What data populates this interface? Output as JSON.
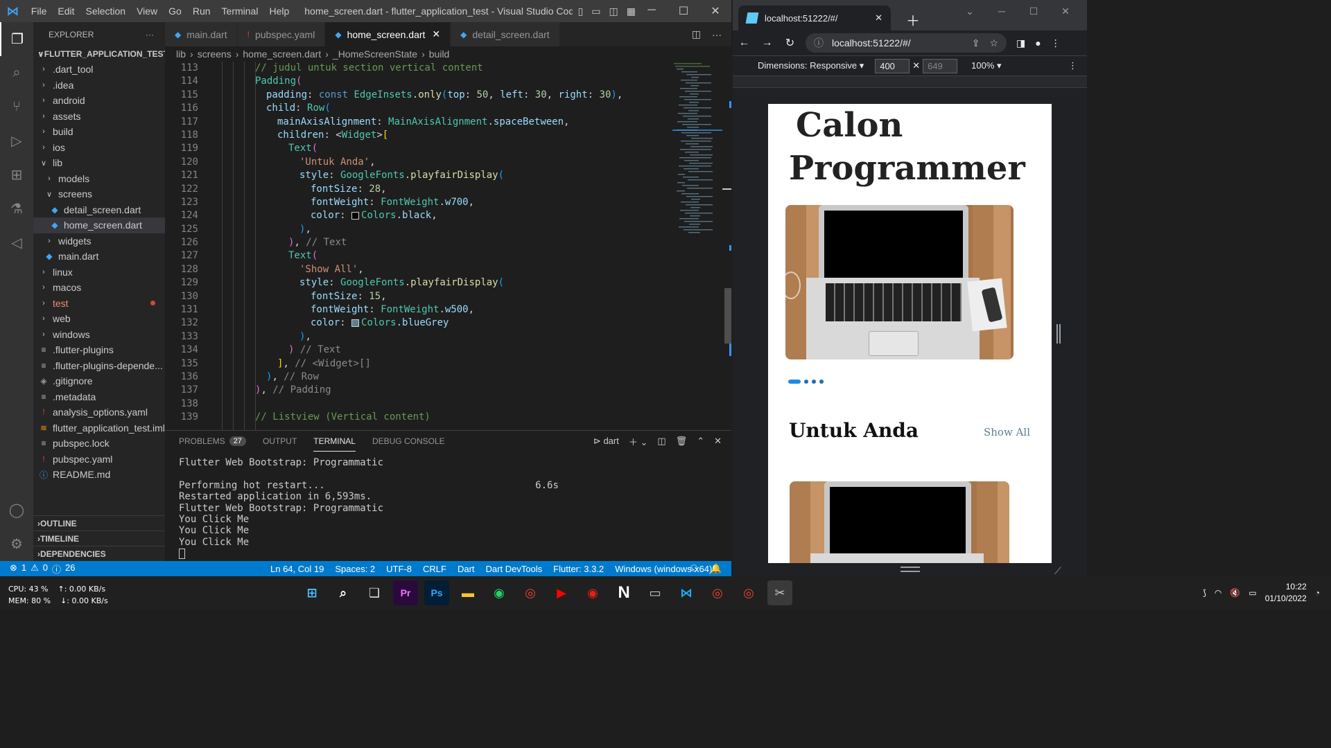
{
  "vscode": {
    "menu": [
      "File",
      "Edit",
      "Selection",
      "View",
      "Go",
      "Run",
      "Terminal",
      "Help"
    ],
    "window_title": "home_screen.dart - flutter_application_test - Visual Studio Code [Admini...",
    "explorer": {
      "header": "EXPLORER",
      "project": "FLUTTER_APPLICATION_TEST",
      "items": [
        {
          "label": ".dart_tool",
          "type": "folder",
          "depth": 1
        },
        {
          "label": ".idea",
          "type": "folder",
          "depth": 1
        },
        {
          "label": "android",
          "type": "folder",
          "depth": 1
        },
        {
          "label": "assets",
          "type": "folder",
          "depth": 1
        },
        {
          "label": "build",
          "type": "folder",
          "depth": 1
        },
        {
          "label": "ios",
          "type": "folder",
          "depth": 1
        },
        {
          "label": "lib",
          "type": "folder-open",
          "depth": 1
        },
        {
          "label": "models",
          "type": "folder",
          "depth": 2
        },
        {
          "label": "screens",
          "type": "folder-open",
          "depth": 2
        },
        {
          "label": "detail_screen.dart",
          "type": "dart",
          "depth": 3
        },
        {
          "label": "home_screen.dart",
          "type": "dart",
          "depth": 3,
          "selected": true
        },
        {
          "label": "widgets",
          "type": "folder",
          "depth": 2
        },
        {
          "label": "main.dart",
          "type": "dart",
          "depth": 2
        },
        {
          "label": "linux",
          "type": "folder",
          "depth": 1
        },
        {
          "label": "macos",
          "type": "folder",
          "depth": 1
        },
        {
          "label": "test",
          "type": "folder",
          "depth": 1,
          "error": true
        },
        {
          "label": "web",
          "type": "folder",
          "depth": 1
        },
        {
          "label": "windows",
          "type": "folder",
          "depth": 1
        },
        {
          "label": ".flutter-plugins",
          "type": "file",
          "depth": 1
        },
        {
          "label": ".flutter-plugins-depende...",
          "type": "file",
          "depth": 1
        },
        {
          "label": ".gitignore",
          "type": "git",
          "depth": 1
        },
        {
          "label": ".metadata",
          "type": "file",
          "depth": 1
        },
        {
          "label": "analysis_options.yaml",
          "type": "yaml",
          "depth": 1
        },
        {
          "label": "flutter_application_test.iml",
          "type": "rss",
          "depth": 1
        },
        {
          "label": "pubspec.lock",
          "type": "file",
          "depth": 1
        },
        {
          "label": "pubspec.yaml",
          "type": "yaml",
          "depth": 1
        },
        {
          "label": "README.md",
          "type": "info",
          "depth": 1
        }
      ],
      "sections": [
        "OUTLINE",
        "TIMELINE",
        "DEPENDENCIES"
      ]
    },
    "tabs": [
      {
        "label": "main.dart",
        "icon": "dart",
        "active": false
      },
      {
        "label": "pubspec.yaml",
        "icon": "yaml",
        "active": false
      },
      {
        "label": "home_screen.dart",
        "icon": "dart",
        "active": true
      },
      {
        "label": "detail_screen.dart",
        "icon": "dart",
        "active": false
      }
    ],
    "breadcrumb": [
      "lib",
      "screens",
      "home_screen.dart",
      "_HomeScreenState",
      "build"
    ],
    "code": [
      {
        "n": "113",
        "indent": 6,
        "tokens": [
          [
            "c-com",
            "// judul untuk section vertical content"
          ]
        ]
      },
      {
        "n": "114",
        "indent": 6,
        "tokens": [
          [
            "c-cls",
            "Padding"
          ],
          [
            "c-p1",
            "("
          ]
        ]
      },
      {
        "n": "115",
        "indent": 8,
        "tokens": [
          [
            "c-prop",
            "padding"
          ],
          [
            "c-def",
            ": "
          ],
          [
            "c-key",
            "const "
          ],
          [
            "c-cls",
            "EdgeInsets"
          ],
          [
            "c-def",
            "."
          ],
          [
            "c-fn",
            "only"
          ],
          [
            "c-p2",
            "("
          ],
          [
            "c-prop",
            "top"
          ],
          [
            "c-def",
            ": "
          ],
          [
            "c-num",
            "50"
          ],
          [
            "c-def",
            ", "
          ],
          [
            "c-prop",
            "left"
          ],
          [
            "c-def",
            ": "
          ],
          [
            "c-num",
            "30"
          ],
          [
            "c-def",
            ", "
          ],
          [
            "c-prop",
            "right"
          ],
          [
            "c-def",
            ": "
          ],
          [
            "c-num",
            "30"
          ],
          [
            "c-p2",
            ")"
          ],
          [
            "c-def",
            ","
          ]
        ]
      },
      {
        "n": "116",
        "indent": 8,
        "tokens": [
          [
            "c-prop",
            "child"
          ],
          [
            "c-def",
            ": "
          ],
          [
            "c-cls",
            "Row"
          ],
          [
            "c-p2",
            "("
          ]
        ]
      },
      {
        "n": "117",
        "indent": 10,
        "tokens": [
          [
            "c-prop",
            "mainAxisAlignment"
          ],
          [
            "c-def",
            ": "
          ],
          [
            "c-cls",
            "MainAxisAlignment"
          ],
          [
            "c-def",
            "."
          ],
          [
            "c-prop",
            "spaceBetween"
          ],
          [
            "c-def",
            ","
          ]
        ]
      },
      {
        "n": "118",
        "indent": 10,
        "tokens": [
          [
            "c-prop",
            "children"
          ],
          [
            "c-def",
            ": <"
          ],
          [
            "c-cls",
            "Widget"
          ],
          [
            "c-def",
            ">"
          ],
          [
            "c-p3",
            "["
          ]
        ]
      },
      {
        "n": "119",
        "indent": 12,
        "tokens": [
          [
            "c-cls",
            "Text"
          ],
          [
            "c-p1",
            "("
          ]
        ]
      },
      {
        "n": "120",
        "indent": 14,
        "tokens": [
          [
            "c-str",
            "'Untuk Anda'"
          ],
          [
            "c-def",
            ","
          ]
        ]
      },
      {
        "n": "121",
        "indent": 14,
        "tokens": [
          [
            "c-prop",
            "style"
          ],
          [
            "c-def",
            ": "
          ],
          [
            "c-cls",
            "GoogleFonts"
          ],
          [
            "c-def",
            "."
          ],
          [
            "c-fn",
            "playfairDisplay"
          ],
          [
            "c-p2",
            "("
          ]
        ]
      },
      {
        "n": "122",
        "indent": 16,
        "tokens": [
          [
            "c-prop",
            "fontSize"
          ],
          [
            "c-def",
            ": "
          ],
          [
            "c-num",
            "28"
          ],
          [
            "c-def",
            ","
          ]
        ]
      },
      {
        "n": "123",
        "indent": 16,
        "tokens": [
          [
            "c-prop",
            "fontWeight"
          ],
          [
            "c-def",
            ": "
          ],
          [
            "c-cls",
            "FontWeight"
          ],
          [
            "c-def",
            "."
          ],
          [
            "c-prop",
            "w700"
          ],
          [
            "c-def",
            ","
          ]
        ]
      },
      {
        "n": "124",
        "indent": 16,
        "tokens": [
          [
            "c-prop",
            "color"
          ],
          [
            "c-def",
            ": "
          ],
          [
            "swatch-black",
            ""
          ],
          [
            "c-cls",
            "Colors"
          ],
          [
            "c-def",
            "."
          ],
          [
            "c-prop",
            "black"
          ],
          [
            "c-def",
            ","
          ]
        ]
      },
      {
        "n": "125",
        "indent": 14,
        "tokens": [
          [
            "c-p2",
            ")"
          ],
          [
            "c-def",
            ","
          ]
        ]
      },
      {
        "n": "126",
        "indent": 12,
        "tokens": [
          [
            "c-p1",
            ")"
          ],
          [
            "c-def",
            ", "
          ],
          [
            "c-hint",
            "// Text"
          ]
        ]
      },
      {
        "n": "127",
        "indent": 12,
        "tokens": [
          [
            "c-cls",
            "Text"
          ],
          [
            "c-p1",
            "("
          ]
        ]
      },
      {
        "n": "128",
        "indent": 14,
        "tokens": [
          [
            "c-str",
            "'Show All'"
          ],
          [
            "c-def",
            ","
          ]
        ]
      },
      {
        "n": "129",
        "indent": 14,
        "tokens": [
          [
            "c-prop",
            "style"
          ],
          [
            "c-def",
            ": "
          ],
          [
            "c-cls",
            "GoogleFonts"
          ],
          [
            "c-def",
            "."
          ],
          [
            "c-fn",
            "playfairDisplay"
          ],
          [
            "c-p2",
            "("
          ]
        ]
      },
      {
        "n": "130",
        "indent": 16,
        "tokens": [
          [
            "c-prop",
            "fontSize"
          ],
          [
            "c-def",
            ": "
          ],
          [
            "c-num",
            "15"
          ],
          [
            "c-def",
            ","
          ]
        ]
      },
      {
        "n": "131",
        "indent": 16,
        "tokens": [
          [
            "c-prop",
            "fontWeight"
          ],
          [
            "c-def",
            ": "
          ],
          [
            "c-cls",
            "FontWeight"
          ],
          [
            "c-def",
            "."
          ],
          [
            "c-prop",
            "w500"
          ],
          [
            "c-def",
            ","
          ]
        ]
      },
      {
        "n": "132",
        "indent": 16,
        "tokens": [
          [
            "c-prop",
            "color"
          ],
          [
            "c-def",
            ": "
          ],
          [
            "swatch-grey",
            ""
          ],
          [
            "c-cls",
            "Colors"
          ],
          [
            "c-def",
            "."
          ],
          [
            "c-prop",
            "blueGrey"
          ]
        ]
      },
      {
        "n": "133",
        "indent": 14,
        "tokens": [
          [
            "c-p2",
            ")"
          ],
          [
            "c-def",
            ","
          ]
        ]
      },
      {
        "n": "134",
        "indent": 12,
        "tokens": [
          [
            "c-p1",
            ")"
          ],
          [
            "c-hint",
            " // Text"
          ]
        ]
      },
      {
        "n": "135",
        "indent": 10,
        "tokens": [
          [
            "c-p3",
            "]"
          ],
          [
            "c-def",
            ", "
          ],
          [
            "c-hint",
            "// <Widget>[]"
          ]
        ]
      },
      {
        "n": "136",
        "indent": 8,
        "tokens": [
          [
            "c-p2",
            ")"
          ],
          [
            "c-def",
            ", "
          ],
          [
            "c-hint",
            "// Row"
          ]
        ]
      },
      {
        "n": "137",
        "indent": 6,
        "tokens": [
          [
            "c-p1",
            ")"
          ],
          [
            "c-def",
            ", "
          ],
          [
            "c-hint",
            "// Padding"
          ]
        ]
      },
      {
        "n": "138",
        "indent": 0,
        "tokens": []
      },
      {
        "n": "139",
        "indent": 6,
        "tokens": [
          [
            "c-com",
            "// Listview (Vertical content)"
          ]
        ]
      }
    ],
    "panel": {
      "tabs": [
        "PROBLEMS",
        "OUTPUT",
        "TERMINAL",
        "DEBUG CONSOLE"
      ],
      "problems_count": "27",
      "active_tab": "TERMINAL",
      "shell": "dart",
      "terminal_lines": [
        "Flutter Web Bootstrap: Programmatic",
        "",
        "Performing hot restart...                                    6.6s",
        "Restarted application in 6,593ms.",
        "Flutter Web Bootstrap: Programmatic",
        "You Click Me",
        "You Click Me",
        "You Click Me"
      ]
    },
    "status": {
      "errors": "1",
      "warnings": "0",
      "infos": "26",
      "position": "Ln 64, Col 19",
      "spaces": "Spaces: 2",
      "encoding": "UTF-8",
      "eol": "CRLF",
      "language": "Dart",
      "devtools": "Dart DevTools",
      "flutter": "Flutter: 3.3.2",
      "device": "Windows (windows-x64)"
    }
  },
  "chrome": {
    "tab_title": "localhost:51222/#/",
    "url": "localhost:51222/#/",
    "devtools": {
      "dimensions_label": "Dimensions: Responsive",
      "width": "400",
      "height": "649",
      "zoom": "100%"
    },
    "app": {
      "title_line1": "Calon",
      "title_line2": "Programmer",
      "section_title": "Untuk Anda",
      "show_all": "Show All"
    }
  },
  "taskbar": {
    "cpu": "CPU: 43 %",
    "mem": "MEM: 80 %",
    "up": "↑: 0.00 KB/s",
    "down": "↓: 0.00 KB/s",
    "time": "10:22",
    "date": "01/10/2022"
  },
  "colors": {
    "vscode_accent": "#007acc",
    "flutter_blue": "#1f8ae0",
    "show_all": "#607d8b"
  }
}
